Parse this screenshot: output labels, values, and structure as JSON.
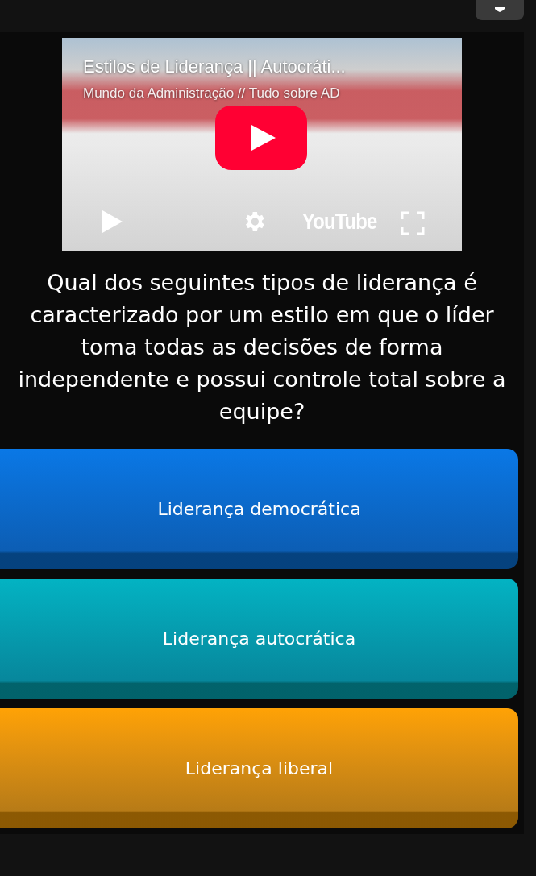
{
  "video": {
    "title": "Estilos de Liderança || Autocráti...",
    "channel": "Mundo da Administração // Tudo sobre AD",
    "logo": "YouTube"
  },
  "question": "Qual dos seguintes tipos de liderança é caracterizado por um estilo em que o líder toma todas as decisões de forma independente e possui controle total sobre a equipe?",
  "options": [
    {
      "label": "Liderança democrática",
      "color": "#0a78e6"
    },
    {
      "label": "Liderança autocrática",
      "color": "#03b3c3"
    },
    {
      "label": "Liderança liberal",
      "color": "#ffa205"
    }
  ]
}
